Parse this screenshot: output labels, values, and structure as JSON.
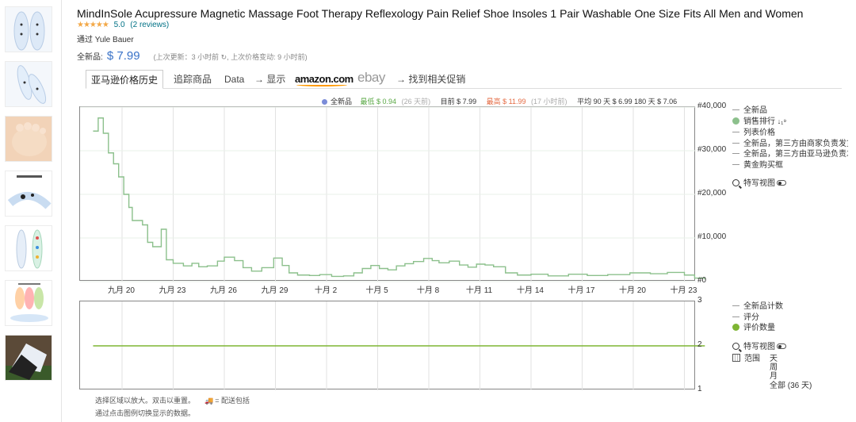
{
  "product": {
    "title": "MindInSole Acupressure Magnetic Massage Foot Therapy Reflexology Pain Relief Shoe Insoles 1 Pair Washable One Size Fits All Men and Women",
    "stars": "★★★★★",
    "rating": "5.0",
    "reviews": "(2 reviews)",
    "byline": "通过 Yule Bauer"
  },
  "price": {
    "label": "全新品:",
    "value": "$ 7.99",
    "meta": "(上次更新：3 小时前 ↻, 上次价格变动: 9 小时前)"
  },
  "tabs": {
    "history": "亚马逊价格历史",
    "track": "追踪商品",
    "data": "Data",
    "show": "→ 显示",
    "amazon": "amazon.com",
    "ebay": "ebay",
    "deals": "→ 找到相关促销"
  },
  "stats": {
    "new_label": "全新品",
    "low": "最低 $ 0.94",
    "low_when": "(26 天前)",
    "current": "目前 $ 7.99",
    "high": "最高 $ 11.99",
    "high_when": "(17 小时前)",
    "avg": "平均 90 天 $ 6.99 180 天 $ 7.06"
  },
  "colors": {
    "sales_rank": "#8cc08c",
    "review_count": "#7eb533",
    "new_price": "#7b8cd8",
    "price_blue": "#3a73c8"
  },
  "chart_data": [
    {
      "type": "line",
      "x_ticks": [
        "九月 20",
        "九月 23",
        "九月 26",
        "九月 29",
        "十月 2",
        "十月 5",
        "十月 8",
        "十月 11",
        "十月 14",
        "十月 17",
        "十月 20",
        "十月 23"
      ],
      "y_ticks": [
        "#40,000",
        "#30,000",
        "#20,000",
        "#10,000",
        "#0"
      ],
      "ylim": [
        0,
        40000
      ],
      "xlim_days": [
        0,
        36.5
      ],
      "series": [
        {
          "name": "销售排行",
          "points": [
            [
              0.3,
              34500
            ],
            [
              0.6,
              37500
            ],
            [
              0.9,
              34000
            ],
            [
              1.2,
              29500
            ],
            [
              1.5,
              27000
            ],
            [
              1.8,
              24000
            ],
            [
              2.1,
              20000
            ],
            [
              2.4,
              17000
            ],
            [
              2.6,
              14000
            ],
            [
              3.2,
              13000
            ],
            [
              3.5,
              9000
            ],
            [
              3.8,
              8000
            ],
            [
              4.3,
              12000
            ],
            [
              4.6,
              5000
            ],
            [
              5.0,
              4200
            ],
            [
              5.6,
              3600
            ],
            [
              6.1,
              4200
            ],
            [
              6.5,
              3400
            ],
            [
              7.0,
              3600
            ],
            [
              7.6,
              4700
            ],
            [
              8.0,
              5600
            ],
            [
              8.6,
              4800
            ],
            [
              9.1,
              3200
            ],
            [
              9.6,
              2400
            ],
            [
              10.2,
              3200
            ],
            [
              10.9,
              5400
            ],
            [
              11.4,
              3700
            ],
            [
              11.8,
              2000
            ],
            [
              12.3,
              1500
            ],
            [
              13.0,
              1400
            ],
            [
              13.6,
              1600
            ],
            [
              14.3,
              1200
            ],
            [
              15.0,
              1300
            ],
            [
              15.6,
              2000
            ],
            [
              16.1,
              3000
            ],
            [
              16.6,
              3700
            ],
            [
              17.1,
              3000
            ],
            [
              17.6,
              2700
            ],
            [
              18.1,
              3600
            ],
            [
              18.6,
              4100
            ],
            [
              19.1,
              4600
            ],
            [
              19.7,
              5300
            ],
            [
              20.2,
              4800
            ],
            [
              20.6,
              4300
            ],
            [
              21.2,
              4700
            ],
            [
              21.8,
              3800
            ],
            [
              22.3,
              3300
            ],
            [
              22.8,
              4000
            ],
            [
              23.3,
              3800
            ],
            [
              23.8,
              3400
            ],
            [
              24.5,
              2000
            ],
            [
              25.2,
              1500
            ],
            [
              26.0,
              1700
            ],
            [
              27.0,
              1300
            ],
            [
              28.2,
              1700
            ],
            [
              29.3,
              1400
            ],
            [
              30.5,
              1600
            ],
            [
              31.8,
              2000
            ],
            [
              33.0,
              1800
            ],
            [
              34.0,
              2100
            ],
            [
              35.0,
              1500
            ],
            [
              35.6,
              800
            ],
            [
              36.2,
              500
            ]
          ]
        }
      ]
    },
    {
      "type": "line",
      "y_ticks": [
        "3",
        "2",
        "1"
      ],
      "ylim": [
        1,
        3
      ],
      "series": [
        {
          "name": "评价数量",
          "points": [
            [
              0.3,
              2
            ],
            [
              36.2,
              2
            ]
          ]
        }
      ]
    }
  ],
  "legend1": {
    "new": "全新品",
    "sales_rank": "销售排行",
    "sort_icon_text": "↓₁⁹",
    "list_price": "列表价格",
    "new_3p": "全新品，第三方由商家负责发货",
    "new_amz": "全新品，第三方由亚马逊负责发货",
    "buybox": "黄金购买框",
    "closeup": "特写视图"
  },
  "legend2": {
    "new_count": "全新品计数",
    "rating": "评分",
    "review_count": "评价数量",
    "closeup": "特写视图",
    "range": "范围",
    "range_day": "天",
    "range_week": "周",
    "range_month": "月",
    "range_all": "全部 (36 天)"
  },
  "footnote": {
    "line1": "选择区域以放大。双击以重置。",
    "truck_text": "= 配送包括",
    "line2": "通过点击图例切换显示的数据。"
  }
}
